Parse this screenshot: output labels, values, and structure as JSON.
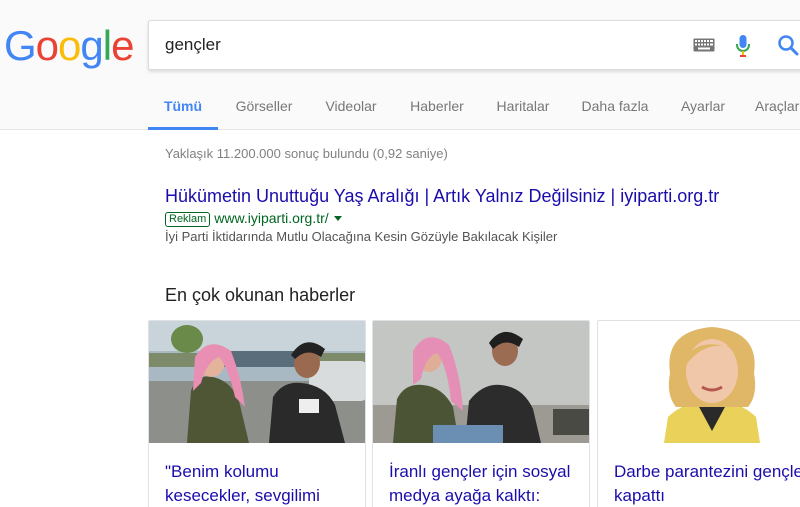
{
  "logo": {
    "letters": [
      "G",
      "o",
      "o",
      "g",
      "l",
      "e"
    ],
    "colors": [
      "#4285f4",
      "#ea4335",
      "#fbbc05",
      "#4285f4",
      "#34a853",
      "#ea4335"
    ]
  },
  "search": {
    "value": "gençler"
  },
  "tabs": [
    {
      "label": "Tümü",
      "active": true
    },
    {
      "label": "Görseller"
    },
    {
      "label": "Videolar"
    },
    {
      "label": "Haberler"
    },
    {
      "label": "Haritalar"
    },
    {
      "label": "Daha fazla"
    },
    {
      "label": "Ayarlar"
    },
    {
      "label": "Araçlar"
    }
  ],
  "result_stats": "Yaklaşık 11.200.000 sonuç bulundu (0,92 saniye)",
  "ad": {
    "title": "Hükümetin Unuttuğu Yaş Aralığı | Artık Yalnız Değilsiniz | iyiparti.org.tr",
    "badge": "Reklam",
    "url": "www.iyiparti.org.tr/",
    "description": "İyi Parti İktidarında Mutlu Olacağına Kesin Gözüyle Bakılacak Kişiler"
  },
  "news": {
    "heading": "En çok okunan haberler",
    "cards": [
      {
        "title": "\"Benim kolumu kesecekler, sevgilimi"
      },
      {
        "title": "İranlı gençler için sosyal medya ayağa kalktı:"
      },
      {
        "title": "Darbe parantezini gençler kapattı"
      }
    ]
  },
  "colors": {
    "link": "#1a0dab",
    "url": "#006621",
    "accent": "#4285f4"
  }
}
